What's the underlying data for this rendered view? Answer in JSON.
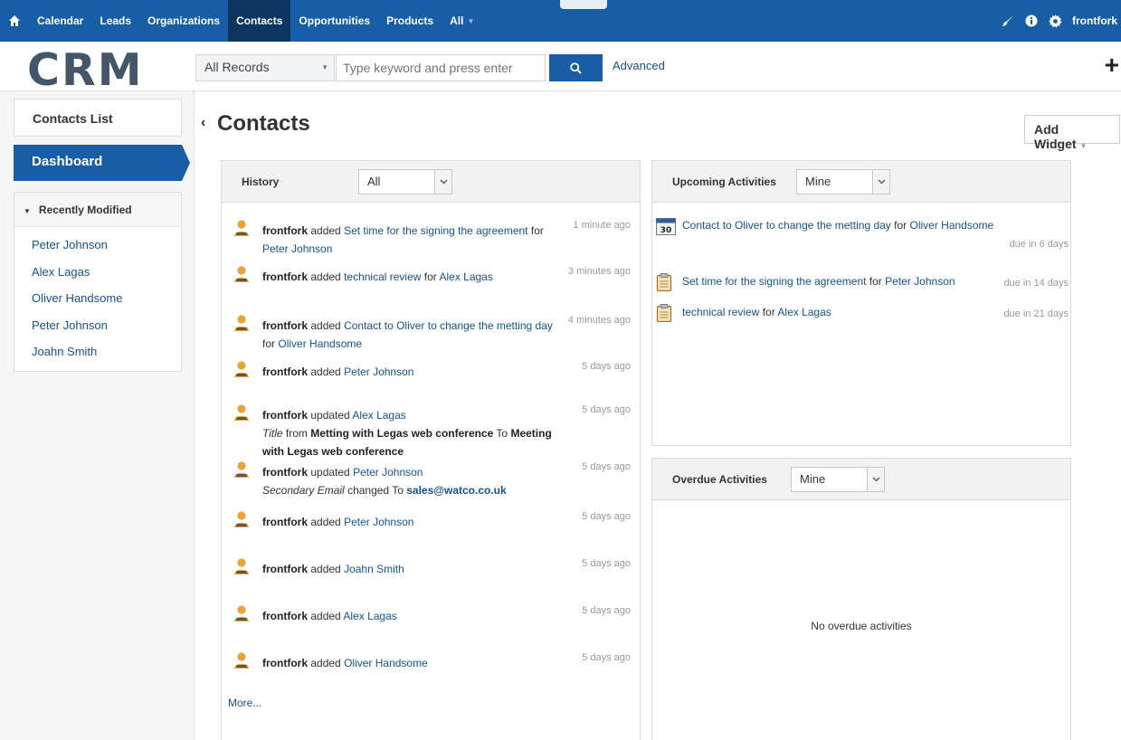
{
  "nav": {
    "items": [
      {
        "label": "Calendar",
        "active": false
      },
      {
        "label": "Leads",
        "active": false
      },
      {
        "label": "Organizations",
        "active": false
      },
      {
        "label": "Contacts",
        "active": true
      },
      {
        "label": "Opportunities",
        "active": false
      },
      {
        "label": "Products",
        "active": false
      },
      {
        "label": "All",
        "active": false
      }
    ],
    "user": "frontfork"
  },
  "header": {
    "logo": "CRM",
    "search_scope": "All Records",
    "search_placeholder": "Type keyword and press enter",
    "advanced": "Advanced",
    "add": "+"
  },
  "sidebar": {
    "contacts_list": "Contacts List",
    "dashboard": "Dashboard",
    "recent_title": "Recently Modified",
    "recent": [
      "Peter Johnson",
      "Alex Lagas",
      "Oliver Handsome",
      "Peter Johnson",
      "Joahn Smith"
    ]
  },
  "main": {
    "title": "Contacts",
    "add_widget": "Add Widget"
  },
  "history": {
    "title": "History",
    "filter": "All",
    "items": [
      {
        "user": "frontfork",
        "action": "added",
        "target": "Set time for the signing the agreement",
        "for_word": "for",
        "for_target": "Peter Johnson",
        "time": "1 minute ago"
      },
      {
        "user": "frontfork",
        "action": "added",
        "target": "technical review",
        "for_word": "for",
        "for_target": "Alex Lagas",
        "time": "3 minutes ago"
      },
      {
        "user": "frontfork",
        "action": "added",
        "target": "Contact to Oliver to change the metting day",
        "for_word": "for",
        "for_target": "Oliver Handsome",
        "time": "4 minutes ago"
      },
      {
        "user": "frontfork",
        "action": "added",
        "target": "Peter Johnson",
        "time": "5 days ago"
      },
      {
        "user": "frontfork",
        "action": "updated",
        "target": "Alex Lagas",
        "time": "5 days ago",
        "field": "Title",
        "from_word": "from",
        "from_value": "Metting with Legas web conference",
        "to_word": "To",
        "to_value": "Meeting with Legas web conference"
      },
      {
        "user": "frontfork",
        "action": "updated",
        "target": "Peter Johnson",
        "time": "5 days ago",
        "field": "Secondary Email",
        "changed_word": "changed To",
        "to_value": "sales@watco.co.uk"
      },
      {
        "user": "frontfork",
        "action": "added",
        "target": "Peter Johnson",
        "time": "5 days ago"
      },
      {
        "user": "frontfork",
        "action": "added",
        "target": "Joahn Smith",
        "time": "5 days ago"
      },
      {
        "user": "frontfork",
        "action": "added",
        "target": "Alex Lagas",
        "time": "5 days ago"
      },
      {
        "user": "frontfork",
        "action": "added",
        "target": "Oliver Handsome",
        "time": "5 days ago"
      }
    ],
    "more": "More..."
  },
  "upcoming": {
    "title": "Upcoming Activities",
    "filter": "Mine",
    "calendar_day": "30",
    "items": [
      {
        "subject": "Contact to Oliver to change the metting day",
        "for_word": "for",
        "for_target": "Oliver Handsome",
        "due": "due in 6 days",
        "icon": "calendar-icon"
      },
      {
        "subject": "Set time for the signing the agreement",
        "for_word": "for",
        "for_target": "Peter Johnson",
        "due": "due in 14 days",
        "icon": "task-icon"
      },
      {
        "subject": "technical review",
        "for_word": "for",
        "for_target": "Alex Lagas",
        "due": "due in 21 days",
        "icon": "task-icon"
      }
    ]
  },
  "overdue": {
    "title": "Overdue Activities",
    "filter": "Mine",
    "empty": "No overdue activities"
  }
}
